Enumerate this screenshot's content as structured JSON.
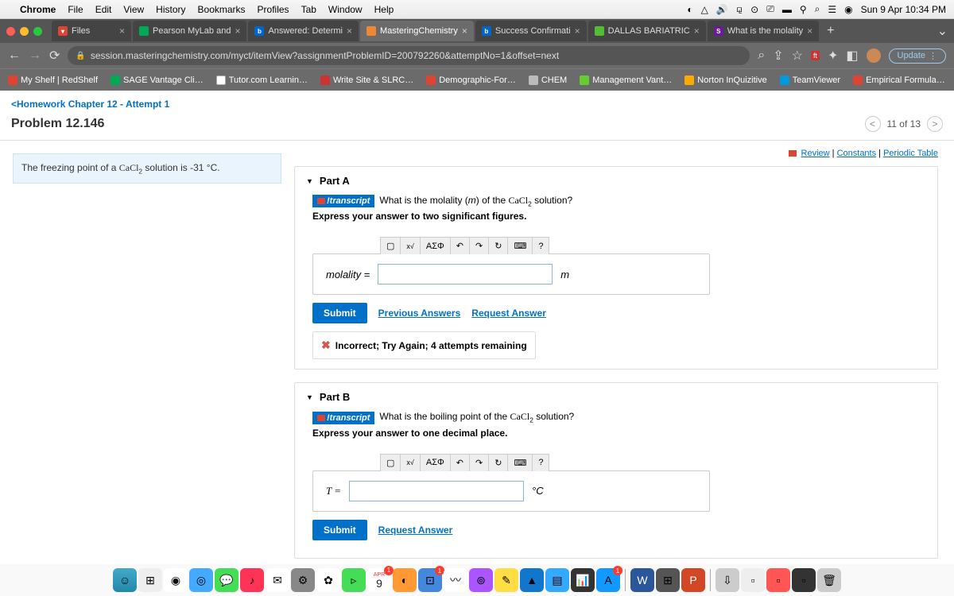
{
  "menubar": {
    "app": "Chrome",
    "items": [
      "File",
      "Edit",
      "View",
      "History",
      "Bookmarks",
      "Profiles",
      "Tab",
      "Window",
      "Help"
    ],
    "datetime": "Sun 9 Apr 10:34 PM"
  },
  "tabs": [
    {
      "label": "Files",
      "favicon": "#d43",
      "active": false
    },
    {
      "label": "Pearson MyLab and",
      "favicon": "#0a5",
      "active": false
    },
    {
      "label": "Answered: Determi",
      "favicon": "#06c",
      "active": false
    },
    {
      "label": "MasteringChemistry",
      "favicon": "#e83",
      "active": true
    },
    {
      "label": "Success Confirmati",
      "favicon": "#06c",
      "active": false
    },
    {
      "label": "DALLAS BARIATRIC",
      "favicon": "#5b3",
      "active": false
    },
    {
      "label": "What is the molality",
      "favicon": "#6a1b9a",
      "favtext": "S",
      "active": false
    }
  ],
  "url": "session.masteringchemistry.com/myct/itemView?assignmentProblemID=200792260&attemptNo=1&offset=next",
  "update_label": "Update",
  "bookmarks": [
    {
      "label": "My Shelf | RedShelf",
      "c": "#d43"
    },
    {
      "label": "SAGE Vantage Cli…",
      "c": "#0a5"
    },
    {
      "label": "Tutor.com Learnin…",
      "c": "#fff"
    },
    {
      "label": "Write Site & SLRC…",
      "c": "#c33"
    },
    {
      "label": "Demographic-For…",
      "c": "#d43"
    },
    {
      "label": "CHEM",
      "c": "#bbb"
    },
    {
      "label": "Management Vant…",
      "c": "#6c3"
    },
    {
      "label": "Norton InQuizitive",
      "c": "#fa0"
    },
    {
      "label": "TeamViewer",
      "c": "#09d"
    },
    {
      "label": "Empirical Formula…",
      "c": "#d43"
    }
  ],
  "breadcrumb": "Homework Chapter 12 - Attempt 1",
  "problem_title": "Problem 12.146",
  "pager": "11 of 13",
  "links": {
    "review": "Review",
    "constants": "Constants",
    "periodic": "Periodic Table"
  },
  "prompt": {
    "pre": "The freezing point of a ",
    "formula": "CaCl₂",
    "post": " solution is -31 °C."
  },
  "partA": {
    "title": "Part A",
    "transcript": "!transcript",
    "q_pre": "What is the molality (",
    "q_var": "m",
    "q_mid": ") of the ",
    "q_formula": "CaCl₂",
    "q_post": " solution?",
    "instr": "Express your answer to two significant figures.",
    "label": "molality =",
    "unit": "m",
    "submit": "Submit",
    "prev": "Previous Answers",
    "req": "Request Answer",
    "feedback": "Incorrect; Try Again; 4 attempts remaining"
  },
  "partB": {
    "title": "Part B",
    "transcript": "!transcript",
    "q_pre": "What is the boiling point of the ",
    "q_formula": "CaCl₂",
    "q_post": " solution?",
    "instr": "Express your answer to one decimal place.",
    "label": "T =",
    "unit": "°C",
    "submit": "Submit",
    "req": "Request Answer"
  },
  "toolbar_greek": "ΑΣΦ",
  "dock_date": {
    "mon": "APR",
    "day": "9"
  }
}
